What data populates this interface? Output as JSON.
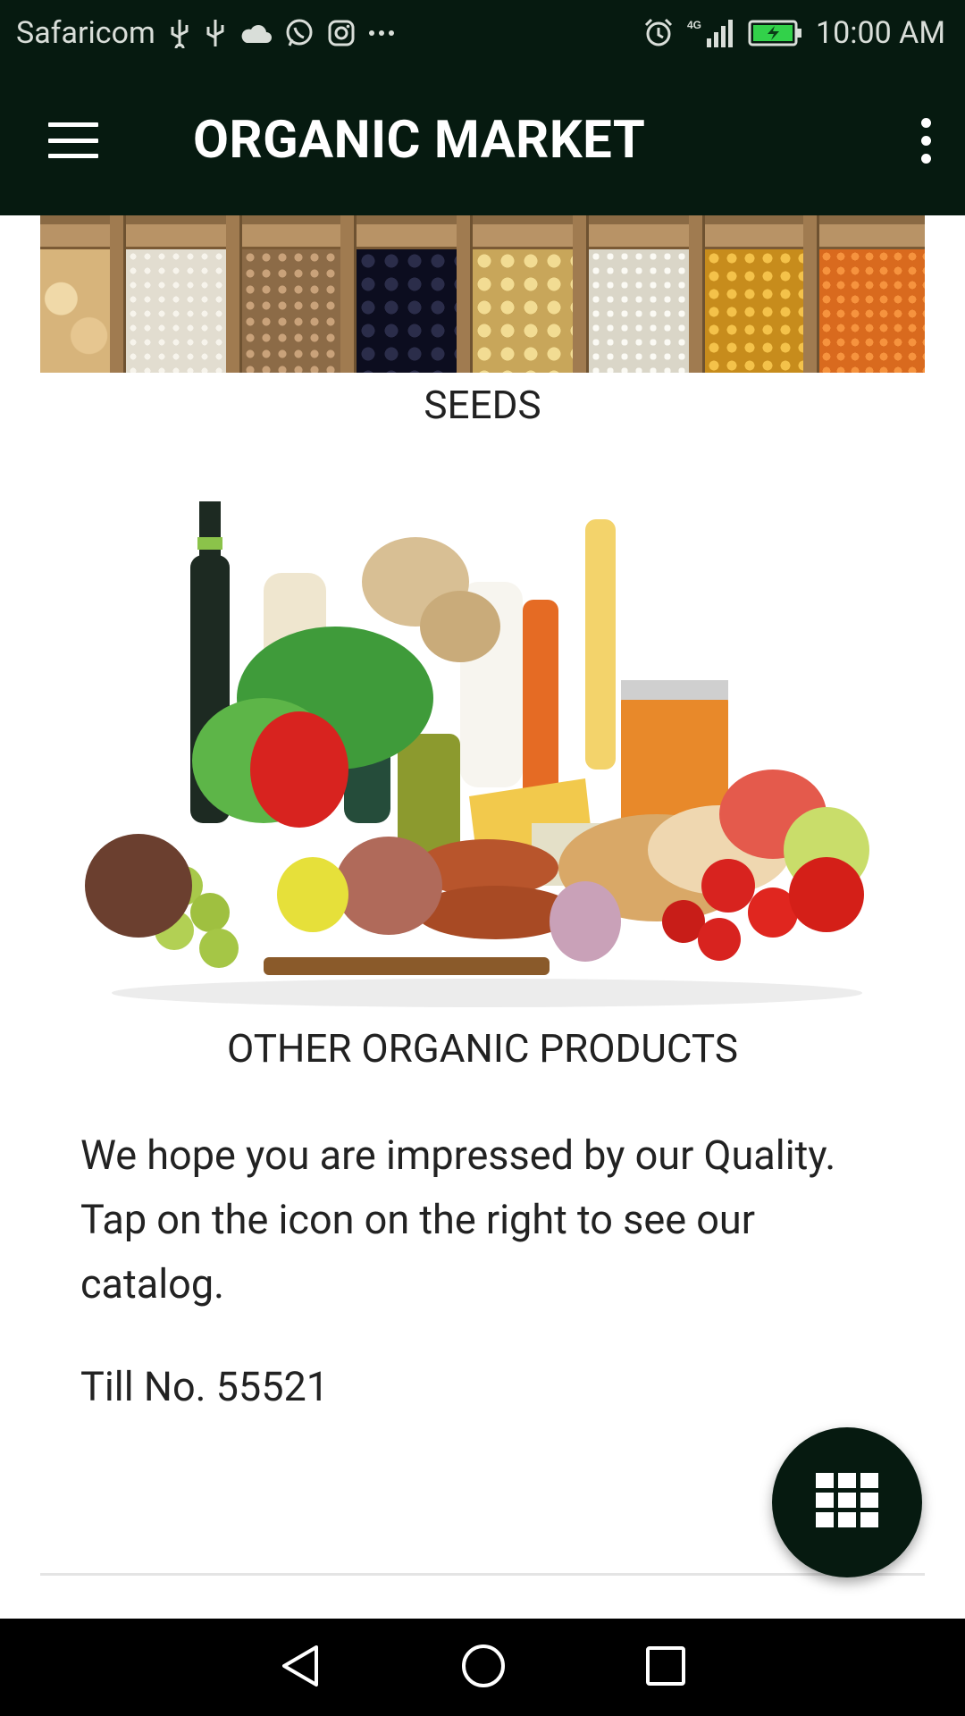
{
  "status_bar": {
    "carrier": "Safaricom",
    "time": "10:00 AM",
    "network": "4G",
    "left_icons": [
      "usb-icon",
      "usb-icon",
      "cloud-icon",
      "whatsapp-icon",
      "instagram-icon",
      "more-dots-icon"
    ],
    "right_icons": [
      "alarm-icon",
      "signal-icon",
      "battery-charging-icon"
    ]
  },
  "app_bar": {
    "title": "ORGANIC MARKET",
    "menu_icon": "hamburger-menu-icon",
    "overflow_icon": "more-vert-icon",
    "background": "#061a10"
  },
  "sections": {
    "seeds": {
      "caption": "SEEDS"
    },
    "products": {
      "caption": "OTHER ORGANIC PRODUCTS"
    }
  },
  "message": {
    "text": "We hope you are impressed by our Quality. Tap on the icon on the right to see our catalog.",
    "till": "Till No. 55521"
  },
  "fab": {
    "icon": "grid-catalog-icon",
    "background": "#061a10"
  },
  "nav_bar": {
    "buttons": [
      "back-icon",
      "home-icon",
      "recents-icon"
    ]
  }
}
